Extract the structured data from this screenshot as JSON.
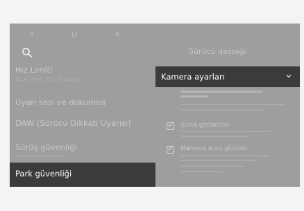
{
  "menu": {
    "items": [
      {
        "label": "Hız Limiti",
        "sublabel": "ISLA (Akıllı Hız Asistanı)"
      },
      {
        "label": "Uyarı sesi ve dokunma",
        "sublabel": ""
      },
      {
        "label": "DAW (Sürücü Dikkati Uyarısı)",
        "sublabel": ""
      },
      {
        "label": "Sürüş güvenliği",
        "sublabel": ""
      },
      {
        "label": "Park güvenliği",
        "sublabel": ""
      }
    ]
  },
  "panel": {
    "title": "Sürücü desteği",
    "dropdown_label": "Kamera ayarları",
    "options": [
      {
        "label": "Sürüş görüntüsü",
        "checked": true
      },
      {
        "label": "Manevra aracı görünür",
        "checked": true
      }
    ]
  },
  "colors": {
    "screen_bg": "#9c9ea0",
    "active_bg": "#3b3b3d"
  },
  "icons": [
    "back-icon",
    "home-icon",
    "close-icon",
    "search-icon",
    "chevron-down-icon",
    "check-icon"
  ]
}
